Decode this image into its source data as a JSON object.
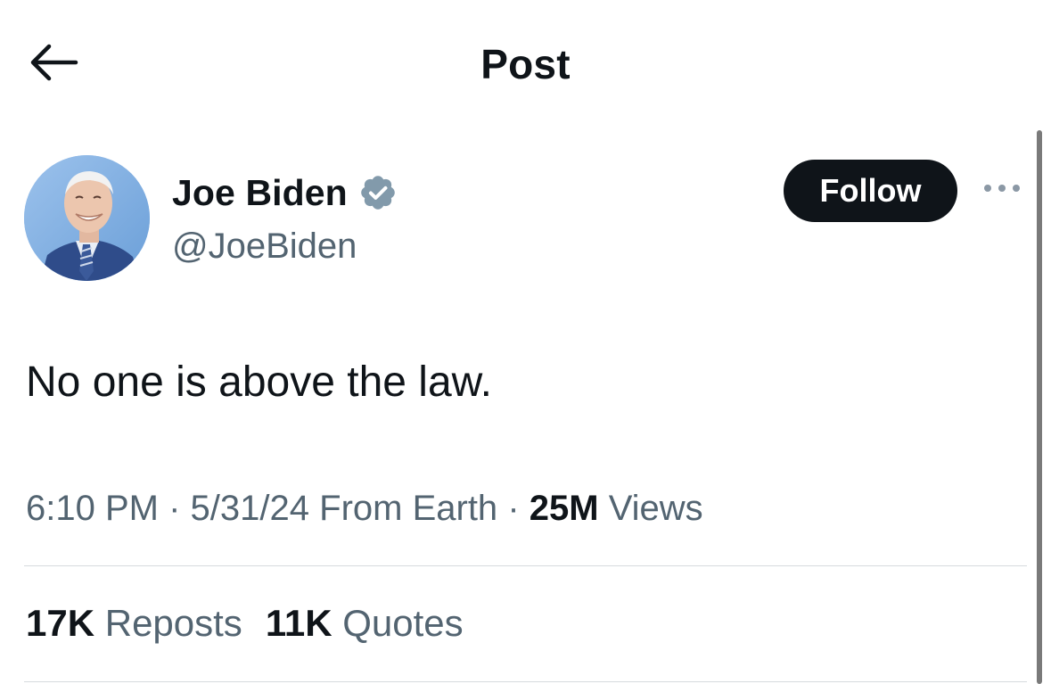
{
  "header": {
    "title": "Post",
    "back_icon": "arrow-left-icon"
  },
  "post": {
    "author": {
      "display_name": "Joe Biden",
      "handle": "@JoeBiden",
      "verified": true,
      "verified_icon": "verified-badge-icon",
      "verified_color": "#829aab",
      "avatar_icon": "avatar-photo"
    },
    "follow_label": "Follow",
    "more_icon": "more-horizontal-icon",
    "text": "No one is above the law.",
    "meta": {
      "time": "6:10 PM",
      "separator1": "·",
      "date": "5/31/24",
      "location": "From Earth",
      "separator2": "·",
      "views_count": "25M",
      "views_label": "Views"
    },
    "stats": {
      "reposts_count": "17K",
      "reposts_label": "Reposts",
      "quotes_count": "11K",
      "quotes_label": "Quotes"
    }
  },
  "colors": {
    "text_primary": "#0f1419",
    "text_secondary": "#536471",
    "follow_bg": "#0f1419",
    "divider": "#d6dadd"
  }
}
